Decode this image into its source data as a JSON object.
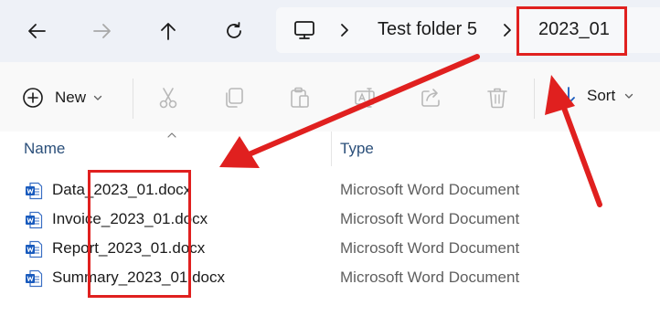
{
  "navigation": {
    "back_icon": "arrow-left-icon",
    "forward_icon": "arrow-right-icon",
    "up_icon": "arrow-up-icon",
    "refresh_icon": "refresh-icon"
  },
  "address_bar": {
    "root_icon": "this-pc-icon",
    "breadcrumbs": [
      "Test folder 5",
      "2023_01"
    ]
  },
  "command_bar": {
    "new_label": "New",
    "sort_label": "Sort",
    "tools": [
      "cut-icon",
      "copy-icon",
      "paste-icon",
      "rename-icon",
      "share-icon",
      "delete-icon"
    ]
  },
  "file_list": {
    "columns": [
      "Name",
      "Type"
    ],
    "rows": [
      {
        "name": "Data_2023_01.docx",
        "type": "Microsoft Word Document"
      },
      {
        "name": "Invoice_2023_01.docx",
        "type": "Microsoft Word Document"
      },
      {
        "name": "Report_2023_01.docx",
        "type": "Microsoft Word Document"
      },
      {
        "name": "Summary_2023_01.docx",
        "type": "Microsoft Word Document"
      }
    ]
  },
  "colors": {
    "annotation": "#e0201f",
    "word_blue": "#185abd",
    "header_text": "#2b4f7a"
  }
}
